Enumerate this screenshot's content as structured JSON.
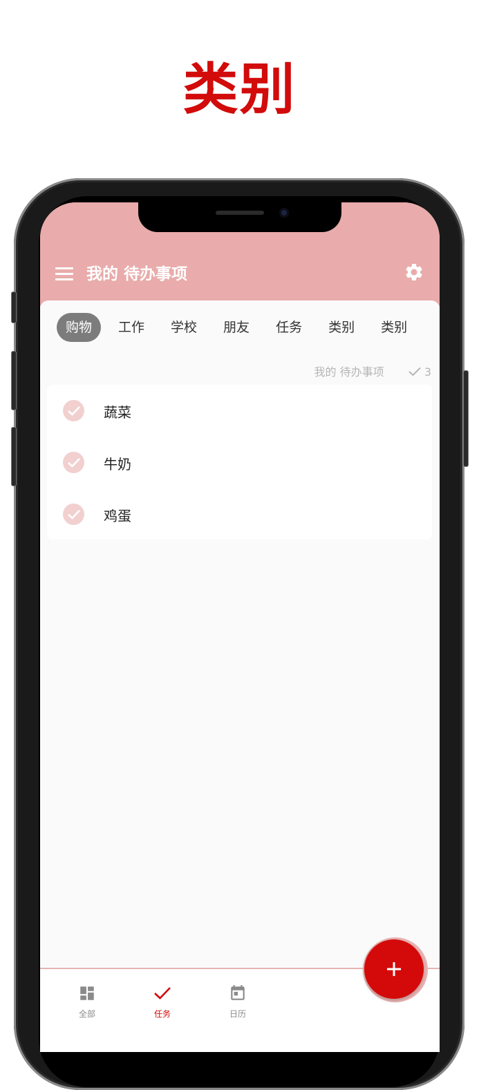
{
  "promo": {
    "title": "类别"
  },
  "header": {
    "title": "我的 待办事项",
    "menu_icon": "menu-icon",
    "settings_icon": "gear-icon"
  },
  "categories": [
    {
      "label": "购物",
      "active": true
    },
    {
      "label": "工作",
      "active": false
    },
    {
      "label": "学校",
      "active": false
    },
    {
      "label": "朋友",
      "active": false
    },
    {
      "label": "任务",
      "active": false
    },
    {
      "label": "类别",
      "active": false
    },
    {
      "label": "类别",
      "active": false
    }
  ],
  "list": {
    "name": "我的 待办事项",
    "count": "3",
    "tasks": [
      {
        "label": "蔬菜"
      },
      {
        "label": "牛奶"
      },
      {
        "label": "鸡蛋"
      }
    ]
  },
  "bottom_nav": [
    {
      "label": "全部",
      "icon": "dashboard-icon",
      "active": false
    },
    {
      "label": "任务",
      "icon": "check-icon",
      "active": true
    },
    {
      "label": "日历",
      "icon": "calendar-icon",
      "active": false
    }
  ],
  "fab": {
    "icon": "plus-icon"
  },
  "colors": {
    "accent": "#d20b0b",
    "header_bg": "#e9abab",
    "check_bg": "#f2d0d0",
    "chip_active_bg": "#7c7c7c"
  }
}
